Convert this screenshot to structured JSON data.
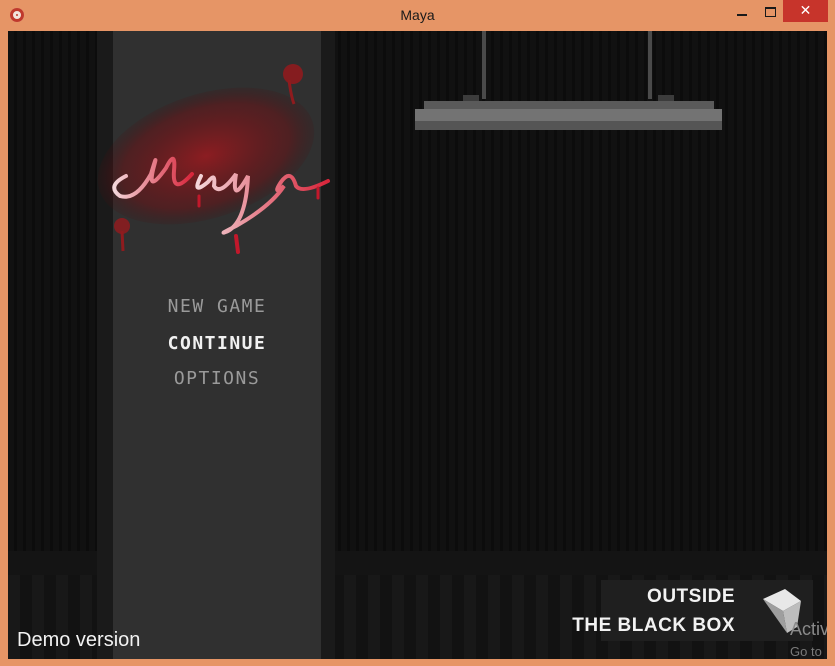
{
  "window": {
    "title": "Maya"
  },
  "game": {
    "logo_text": "Maya",
    "menu": [
      {
        "label": "NEW GAME"
      },
      {
        "label": "CONTINUE"
      },
      {
        "label": "OPTIONS"
      }
    ],
    "selected_menu_item": "CONTINUE",
    "demo_label": "Demo version",
    "studio": {
      "line1": "OUTSIDE",
      "line2": "THE BLACK BOX"
    }
  },
  "overlay": {
    "activation_line1": "Activ",
    "activation_line2": "Go to"
  },
  "colors": {
    "titlebar": "#e69566",
    "close": "#c7342b",
    "blood": "#b3121e"
  }
}
